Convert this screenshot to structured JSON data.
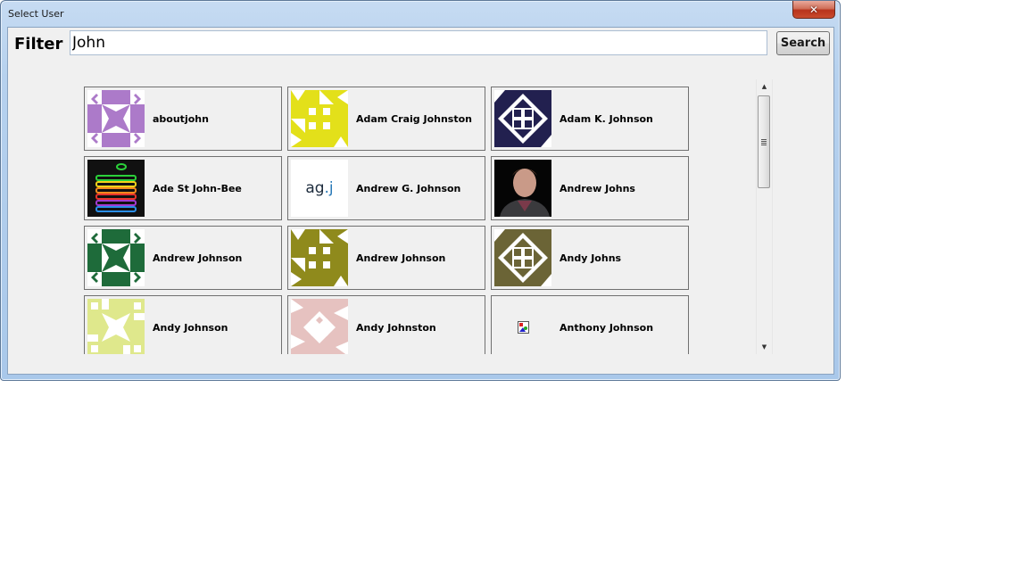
{
  "window": {
    "title": "Select User",
    "close_glyph": "✕"
  },
  "filter": {
    "label": "Filter",
    "value": "John",
    "search_label": "Search"
  },
  "users": [
    {
      "name": "aboutjohn",
      "avatar": "identicon",
      "color": "#ac7ac9"
    },
    {
      "name": "Adam Craig Johnston",
      "avatar": "identicon",
      "color": "#e3e01a"
    },
    {
      "name": "Adam K. Johnson",
      "avatar": "identicon",
      "color": "#22204f"
    },
    {
      "name": "Ade St John-Bee",
      "avatar": "photo-rainbow-apple",
      "color": "#000000"
    },
    {
      "name": "Andrew G. Johnson",
      "avatar": "text-logo",
      "logo_text": "ag.j",
      "color": "#2a7ab8"
    },
    {
      "name": "Andrew Johns",
      "avatar": "photo-portrait",
      "color": "#000000"
    },
    {
      "name": "Andrew Johnson",
      "avatar": "identicon",
      "color": "#1e6b3a"
    },
    {
      "name": "Andrew Johnson",
      "avatar": "identicon",
      "color": "#8f8a1c"
    },
    {
      "name": "Andy Johns",
      "avatar": "identicon",
      "color": "#6b6436"
    },
    {
      "name": "Andy Johnson",
      "avatar": "identicon",
      "color": "#dfe88c"
    },
    {
      "name": "Andy Johnston",
      "avatar": "identicon",
      "color": "#e6c2c0"
    },
    {
      "name": "Anthony Johnson",
      "avatar": "broken-image",
      "color": "#ffffff"
    }
  ],
  "scrollbar": {
    "up_glyph": "▲",
    "down_glyph": "▼",
    "position_fraction": 0.0
  }
}
